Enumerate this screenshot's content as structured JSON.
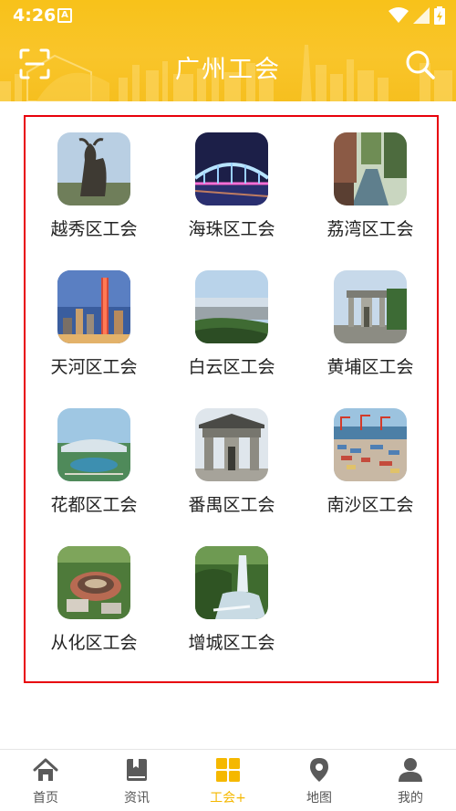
{
  "status_bar": {
    "time": "4:26",
    "notification_badge": "A"
  },
  "header": {
    "title": "广州工会",
    "accent_color": "#f8c21a"
  },
  "districts": [
    {
      "label": "越秀区工会",
      "icon": "goat-statue-photo"
    },
    {
      "label": "海珠区工会",
      "icon": "lit-bridge-photo"
    },
    {
      "label": "荔湾区工会",
      "icon": "canal-street-photo"
    },
    {
      "label": "天河区工会",
      "icon": "tower-skyline-photo"
    },
    {
      "label": "白云区工会",
      "icon": "mountain-city-view-photo"
    },
    {
      "label": "黄埔区工会",
      "icon": "memorial-archway-photo"
    },
    {
      "label": "花都区工会",
      "icon": "airport-terminal-photo"
    },
    {
      "label": "番禺区工会",
      "icon": "stone-archway-photo"
    },
    {
      "label": "南沙区工会",
      "icon": "container-port-photo"
    },
    {
      "label": "从化区工会",
      "icon": "round-earth-building-photo"
    },
    {
      "label": "增城区工会",
      "icon": "waterfall-photo"
    }
  ],
  "tabs": [
    {
      "label": "首页",
      "icon": "home-icon",
      "active": false
    },
    {
      "label": "资讯",
      "icon": "news-book-icon",
      "active": false
    },
    {
      "label": "工会+",
      "icon": "grid-squares-icon",
      "active": true
    },
    {
      "label": "地图",
      "icon": "map-pin-icon",
      "active": false
    },
    {
      "label": "我的",
      "icon": "person-icon",
      "active": false
    }
  ],
  "colors": {
    "active_tab": "#f5b800",
    "inactive_tab": "#555555",
    "highlight_border": "#e8000b"
  }
}
